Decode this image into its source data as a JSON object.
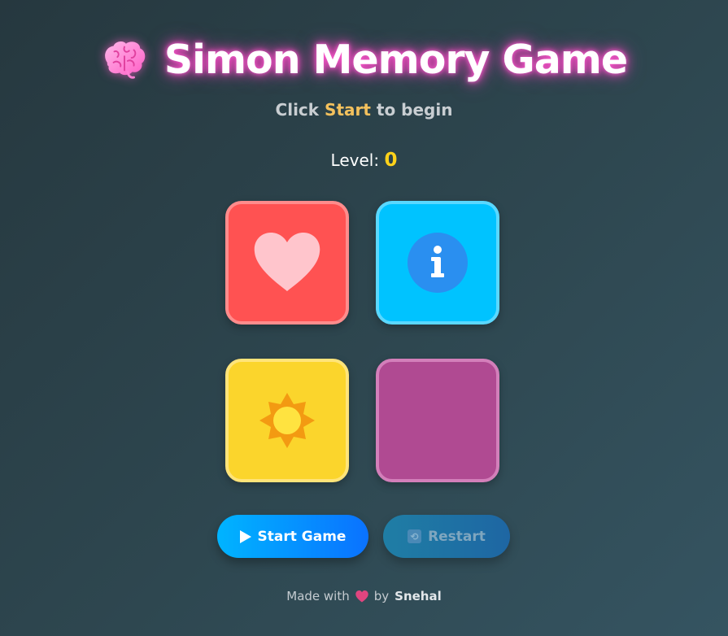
{
  "header": {
    "title": "Simon Memory Game",
    "title_icon": "brain-icon",
    "title_glow_color": "#ff3fc3"
  },
  "status": {
    "prefix": "Click",
    "highlight": "Start",
    "suffix": "to begin",
    "highlight_color": "#f4c15d"
  },
  "level": {
    "label": "Level:",
    "value": "0",
    "value_color": "#ffd21a"
  },
  "pads": [
    {
      "color": "#ff5252",
      "icon": "heart-icon"
    },
    {
      "color": "#00c3ff",
      "icon": "info-icon"
    },
    {
      "color": "#fbd52c",
      "icon": "sun-icon"
    },
    {
      "color": "#b04a92",
      "icon": ""
    }
  ],
  "buttons": {
    "start_icon": "play-icon",
    "start_label": "Start Game",
    "restart_icon": "repeat-icon",
    "restart_label": "Restart"
  },
  "footer": {
    "made_with": "Made with",
    "heart": "heart-icon",
    "by": "by",
    "author": "Snehal"
  }
}
